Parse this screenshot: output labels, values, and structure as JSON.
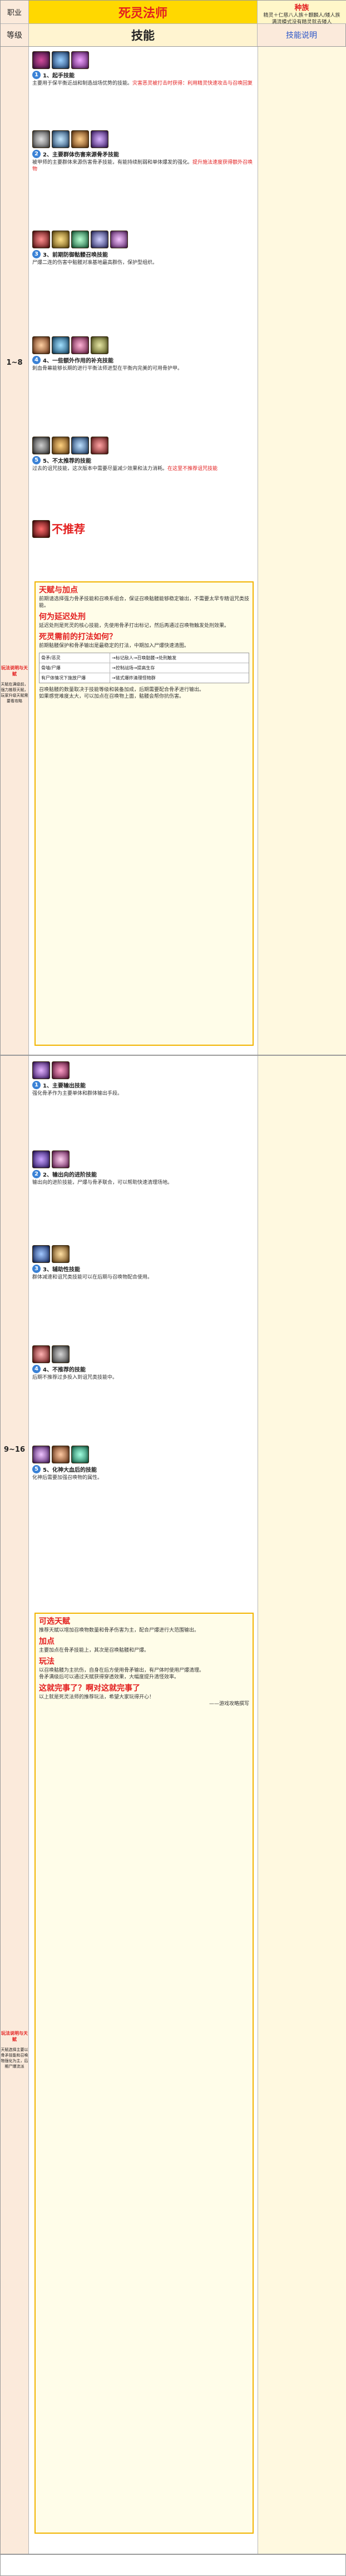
{
  "header": {
    "job_label": "职业",
    "title": "死灵法师",
    "race_label": "种族",
    "race_value": "精灵＋仁慈八人族＋麒麟人/矮人族\n满流模式没有精灵就去矮人",
    "level_label": "等级",
    "skill_label": "技能",
    "explain_label": "技能说明"
  },
  "section1": {
    "level": "1~8",
    "side_note": "玩法说明与天赋",
    "side_sub": "天赋在满级前，强力推荐天赋，玩家升级天赋需要看攻略",
    "skills": [
      {
        "num": "1",
        "title": "1、起手技能",
        "text": "主要用于保平衡近战和制造战场优势的技能。",
        "highlight": "灾害恶灵被打击时获得：利用精灵快速攻击与召唤回复"
      },
      {
        "num": "2",
        "title": "2、主要群体伤害来源骨矛技能",
        "text": "被甲师的主要群体来源伤害骨矛技能，有能持续削弱和单体爆发的强化。",
        "highlight": "提升施法速度获得额外召唤物"
      },
      {
        "num": "3",
        "title": "3、前期防御骷髅召唤技能",
        "text": "尸爆二连的伤害中骷髅对准基地最高群伤，保护型组织。",
        "highlight": ""
      },
      {
        "num": "4",
        "title": "4、一些额外作用的补充技能",
        "text": "刺血骨幕能够长期的进行平衡法师进型在平衡内完美的可用骨护甲。",
        "highlight": ""
      },
      {
        "num": "5",
        "title": "5、不太推荐的技能",
        "text": "过去的诅咒技能，这次版本中需要尽量减少效果和法力消耗。",
        "highlight": "在这里不推荐诅咒技能"
      }
    ],
    "no_rec": "不推荐"
  },
  "guide1": {
    "h1": "天赋与加点",
    "p1": "前期请选择强力骨矛技能和召唤系组合，保证召唤骷髅能够稳定输出，不需要太早专精诅咒类技能。",
    "h2": "何为延迟处刑",
    "p2": "延迟处刑是死灵的核心技能，先使用骨矛打出标记，然后再通过召唤物触发处刑效果。",
    "h3": "死灵需前的打法如何？",
    "p3": "前期骷髅保护和骨矛输出是最稳定的打法，中期加入尸爆快速清图。",
    "flow": [
      {
        "left": "骨矛/恶灵",
        "right": "→标记敌人→召唤骷髅→处刑触发"
      },
      {
        "left": "骨墙/尸爆",
        "right": "→控制战场→提高生存"
      },
      {
        "left": "有尸体情况下施放尸爆",
        "right": "→链式爆炸清理怪物群"
      }
    ],
    "p4": "召唤骷髅的数量取决于技能等级和装备加成，后期需要配合骨矛进行输出。",
    "p5": "如果感觉难度太大，可以加点在召唤物上面，骷髅会帮你抗伤害。"
  },
  "section2": {
    "level": "9~16",
    "side_note": "玩法说明与天赋",
    "side_sub": "天赋选择主要以骨矛技能和召唤物强化为主，后期尸爆流派",
    "skills": [
      {
        "num": "1",
        "title": "1、主要输出技能",
        "text": "强化骨矛作为主要单体和群体输出手段。",
        "highlight": ""
      },
      {
        "num": "2",
        "title": "2、输出向的进阶技能",
        "text": "输出向的进阶技能，尸爆与骨矛联合，可以帮助快速清理场地。",
        "highlight": ""
      },
      {
        "num": "3",
        "title": "3、辅助性技能",
        "text": "群体减速和诅咒类技能可以在后期与召唤物配合使用。",
        "highlight": ""
      },
      {
        "num": "4",
        "title": "4、不推荐的技能",
        "text": "后期不推荐过多投入到诅咒类技能中。",
        "highlight": ""
      },
      {
        "num": "5",
        "title": "5、化神大血后的技能",
        "text": "化神后需要加强召唤物的属性。",
        "highlight": ""
      }
    ]
  },
  "guide2": {
    "h1": "可选天赋",
    "p1": "推荐天赋以增加召唤物数量和骨矛伤害为主，配合尸爆进行大范围输出。",
    "h2": "加点",
    "p2": "主要加点在骨矛技能上，其次是召唤骷髅和尸爆。",
    "h3": "玩法",
    "p3": "以召唤骷髅为主抗伤，自身在后方使用骨矛输出，有尸体时使用尸爆清理。",
    "p4": "骨矛满级后可以通过天赋获得穿透效果，大幅度提升清怪效率。",
    "h4": "这就完事了？啊对这就完事了",
    "p5": "以上就是死灵法师的推荐玩法，希望大家玩得开心！",
    "sign": "——游戏攻略撰写"
  }
}
